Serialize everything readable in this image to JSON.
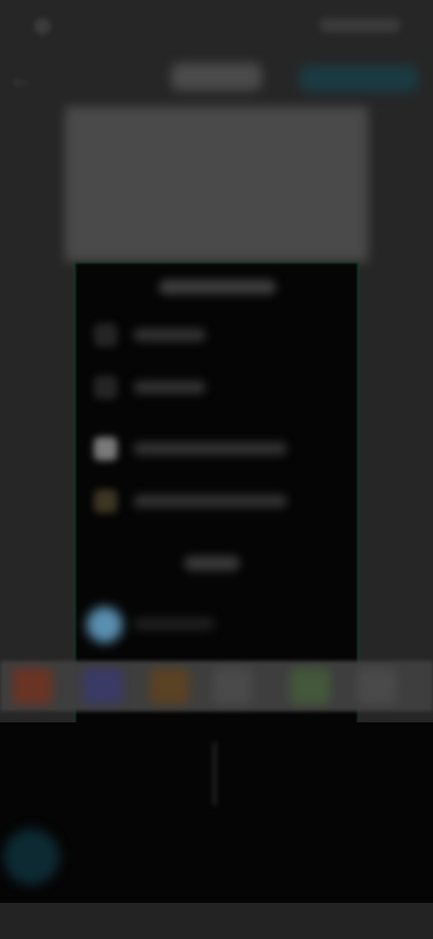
{
  "status_bar": {
    "time": "",
    "icons": [
      "signal-icon",
      "wifi-icon",
      "battery-icon"
    ]
  },
  "top_bar": {
    "title": "",
    "action_label": ""
  },
  "image_frame": {
    "title": "",
    "rows": [
      {
        "icon": "circle-icon",
        "label": ""
      },
      {
        "icon": "circle-icon",
        "label": ""
      },
      {
        "icon": "document-icon",
        "label": ""
      },
      {
        "icon": "sun-icon",
        "label": ""
      }
    ],
    "button_label": "",
    "avatar_label": ""
  },
  "filters": [
    {
      "name": "",
      "color": "#6a3424"
    },
    {
      "name": "",
      "color": "#3a3a66"
    },
    {
      "name": "",
      "color": "#5a4224"
    },
    {
      "name": "",
      "color": "#4a4a4a"
    },
    {
      "name": "",
      "color": "#44583a"
    },
    {
      "name": "",
      "color": "#4a4a4a"
    }
  ],
  "colors": {
    "accent": "#1b3a42",
    "background": "#262626",
    "panel": "#050505"
  }
}
